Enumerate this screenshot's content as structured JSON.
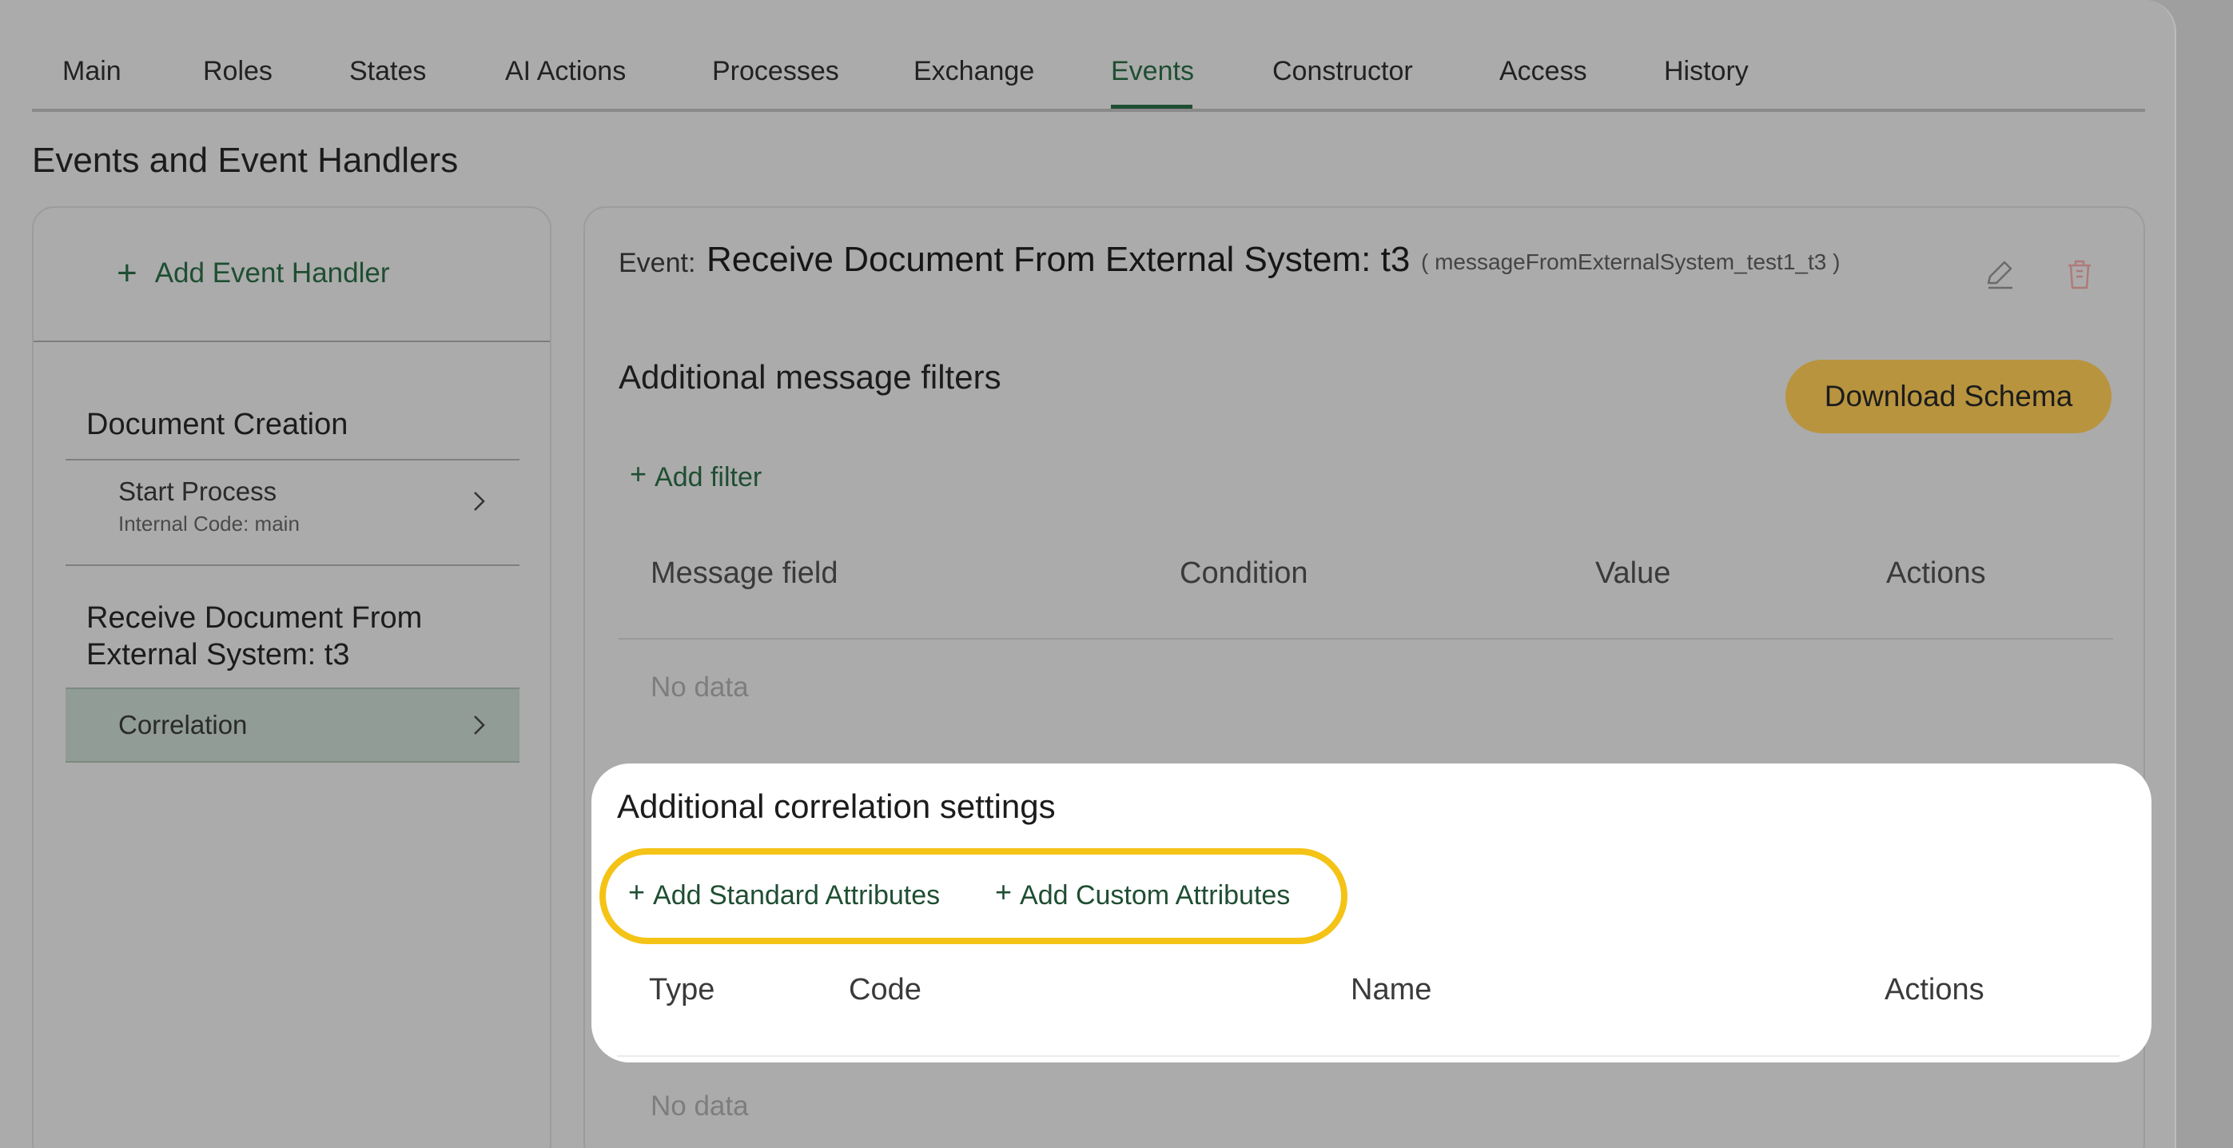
{
  "tabs": [
    {
      "label": "Main"
    },
    {
      "label": "Roles"
    },
    {
      "label": "States"
    },
    {
      "label": "AI Actions"
    },
    {
      "label": "Processes"
    },
    {
      "label": "Exchange"
    },
    {
      "label": "Events",
      "active": true
    },
    {
      "label": "Constructor"
    },
    {
      "label": "Access"
    },
    {
      "label": "History"
    }
  ],
  "page_title": "Events and Event Handlers",
  "sidebar": {
    "add_handler_label": "Add Event Handler",
    "groups": [
      {
        "title": "Document Creation",
        "items": [
          {
            "label": "Start Process",
            "sub": "Internal Code: main"
          }
        ]
      },
      {
        "title_lines": [
          "Receive Document From",
          "External System: t3"
        ],
        "items": [
          {
            "label": "Correlation",
            "selected": true
          }
        ]
      }
    ]
  },
  "event": {
    "label": "Event:",
    "name": "Receive Document From External System: t3",
    "code": "( messageFromExternalSystem_test1_t3 )",
    "edit_icon": "pencil-icon",
    "delete_icon": "trash-icon"
  },
  "filters": {
    "title": "Additional message filters",
    "download_label": "Download Schema",
    "add_filter_label": "Add filter",
    "columns": [
      "Message field",
      "Condition",
      "Value",
      "Actions"
    ],
    "empty_text": "No data"
  },
  "correlation": {
    "title": "Additional correlation settings",
    "add_standard_label": "Add Standard Attributes",
    "add_custom_label": "Add Custom Attributes",
    "columns": [
      "Type",
      "Code",
      "Name",
      "Actions"
    ],
    "empty_text": "No data"
  },
  "colors": {
    "accent": "#1f4e32",
    "download_button": "#b8943f",
    "callout": "#f4c316"
  }
}
